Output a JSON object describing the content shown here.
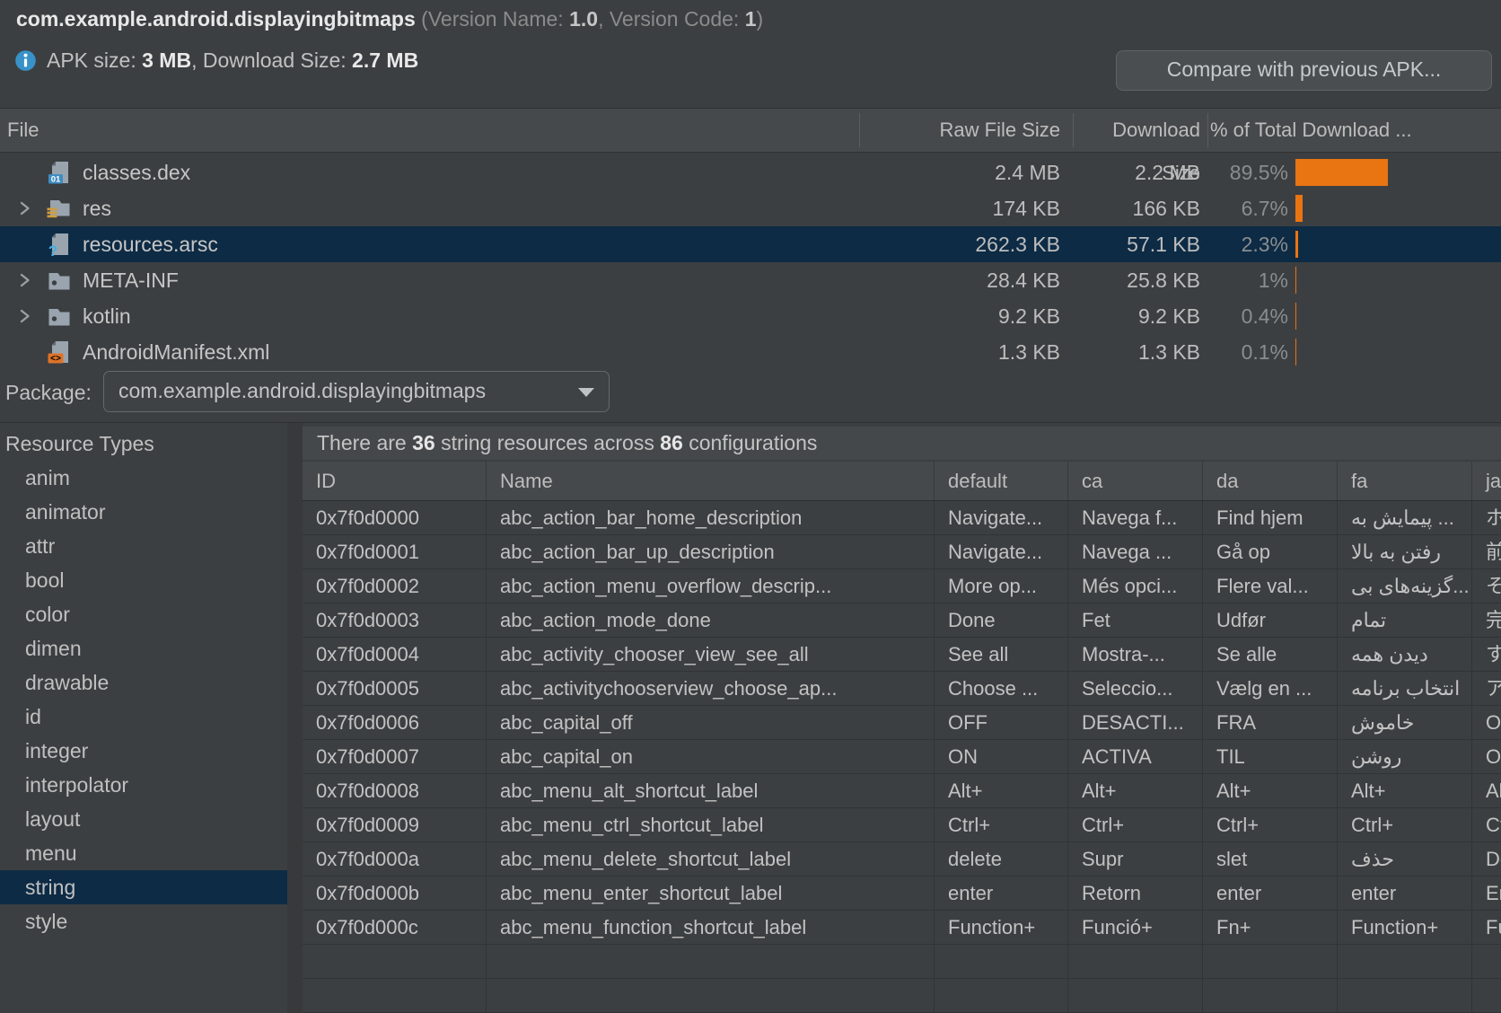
{
  "header": {
    "app_name": "com.example.android.displayingbitmaps",
    "version_prefix": " (Version Name: ",
    "version_name": "1.0",
    "version_sep": ", Version Code: ",
    "version_code": "1",
    "version_close": ")",
    "apk_size_label": "APK size: ",
    "apk_size": "3 MB",
    "download_size_label": ", Download Size: ",
    "download_size": "2.7 MB",
    "compare_button_label": "Compare with previous APK...",
    "info_icon": "info-icon",
    "info_color": "#3892c7"
  },
  "file_table": {
    "columns": {
      "file": "File",
      "raw": "Raw File Size",
      "download": "Download Size",
      "pct": "% of Total Download ..."
    },
    "bar_color": "#e97412",
    "rows": [
      {
        "name": "classes.dex",
        "icon": "dex-file",
        "expandable": false,
        "selected": false,
        "raw": "2.4 MB",
        "download": "2.2 MB",
        "pct_label": "89.5%",
        "pct": 89.5
      },
      {
        "name": "res",
        "icon": "res-folder",
        "expandable": true,
        "selected": false,
        "raw": "174 KB",
        "download": "166 KB",
        "pct_label": "6.7%",
        "pct": 6.7
      },
      {
        "name": "resources.arsc",
        "icon": "arsc-file",
        "expandable": false,
        "selected": true,
        "raw": "262.3 KB",
        "download": "57.1 KB",
        "pct_label": "2.3%",
        "pct": 2.3
      },
      {
        "name": "META-INF",
        "icon": "folder",
        "expandable": true,
        "selected": false,
        "raw": "28.4 KB",
        "download": "25.8 KB",
        "pct_label": "1%",
        "pct": 1
      },
      {
        "name": "kotlin",
        "icon": "folder",
        "expandable": true,
        "selected": false,
        "raw": "9.2 KB",
        "download": "9.2 KB",
        "pct_label": "0.4%",
        "pct": 0.4
      },
      {
        "name": "AndroidManifest.xml",
        "icon": "manifest-file",
        "expandable": false,
        "selected": false,
        "raw": "1.3 KB",
        "download": "1.3 KB",
        "pct_label": "0.1%",
        "pct": 0.1
      }
    ]
  },
  "package_bar": {
    "label": "Package:",
    "selected_value": "com.example.android.displayingbitmaps"
  },
  "resources": {
    "sidebar_title": "Resource Types",
    "types": [
      "anim",
      "animator",
      "attr",
      "bool",
      "color",
      "dimen",
      "drawable",
      "id",
      "integer",
      "interpolator",
      "layout",
      "menu",
      "string",
      "style"
    ],
    "selected_type": "string",
    "summary": {
      "prefix": "There are ",
      "string_count": "36",
      "middle": " string resources across ",
      "config_count": "86",
      "suffix": " configurations"
    },
    "columns": [
      "ID",
      "Name",
      "default",
      "ca",
      "da",
      "fa",
      "ja"
    ],
    "rows": [
      {
        "id": "0x7f0d0000",
        "name": "abc_action_bar_home_description",
        "default": "Navigate...",
        "ca": "Navega f...",
        "da": "Find hjem",
        "fa": "پیمایش به ...",
        "ja": "ホーム..."
      },
      {
        "id": "0x7f0d0001",
        "name": "abc_action_bar_up_description",
        "default": "Navigate...",
        "ca": "Navega ...",
        "da": "Gå op",
        "fa": "رفتن به بالا",
        "ja": "前に..."
      },
      {
        "id": "0x7f0d0002",
        "name": "abc_action_menu_overflow_descrip...",
        "default": "More op...",
        "ca": "Més opci...",
        "da": "Flere val...",
        "fa": "گزینه‌های بی...",
        "ja": "その..."
      },
      {
        "id": "0x7f0d0003",
        "name": "abc_action_mode_done",
        "default": "Done",
        "ca": "Fet",
        "da": "Udfør",
        "fa": "تمام",
        "ja": "完了"
      },
      {
        "id": "0x7f0d0004",
        "name": "abc_activity_chooser_view_see_all",
        "default": "See all",
        "ca": "Mostra-...",
        "da": "Se alle",
        "fa": "دیدن همه",
        "ja": "すべて..."
      },
      {
        "id": "0x7f0d0005",
        "name": "abc_activitychooserview_choose_ap...",
        "default": "Choose ...",
        "ca": "Seleccio...",
        "da": "Vælg en ...",
        "fa": "انتخاب برنامه",
        "ja": "アプリ..."
      },
      {
        "id": "0x7f0d0006",
        "name": "abc_capital_off",
        "default": "OFF",
        "ca": "DESACTI...",
        "da": "FRA",
        "fa": "خاموش",
        "ja": "OFF"
      },
      {
        "id": "0x7f0d0007",
        "name": "abc_capital_on",
        "default": "ON",
        "ca": "ACTIVA",
        "da": "TIL",
        "fa": "روشن",
        "ja": "ON"
      },
      {
        "id": "0x7f0d0008",
        "name": "abc_menu_alt_shortcut_label",
        "default": "Alt+",
        "ca": "Alt+",
        "da": "Alt+",
        "fa": "Alt+",
        "ja": "Alt+"
      },
      {
        "id": "0x7f0d0009",
        "name": "abc_menu_ctrl_shortcut_label",
        "default": "Ctrl+",
        "ca": "Ctrl+",
        "da": "Ctrl+",
        "fa": "Ctrl+",
        "ja": "Ctrl+"
      },
      {
        "id": "0x7f0d000a",
        "name": "abc_menu_delete_shortcut_label",
        "default": "delete",
        "ca": "Supr",
        "da": "slet",
        "fa": "حذف",
        "ja": "Del"
      },
      {
        "id": "0x7f0d000b",
        "name": "abc_menu_enter_shortcut_label",
        "default": "enter",
        "ca": "Retorn",
        "da": "enter",
        "fa": "enter",
        "ja": "Enter"
      },
      {
        "id": "0x7f0d000c",
        "name": "abc_menu_function_shortcut_label",
        "default": "Function+",
        "ca": "Funció+",
        "da": "Fn+",
        "fa": "Function+",
        "ja": "Function+"
      }
    ],
    "trailing_empty_rows": 2,
    "selection_color": "#0d2b45"
  }
}
